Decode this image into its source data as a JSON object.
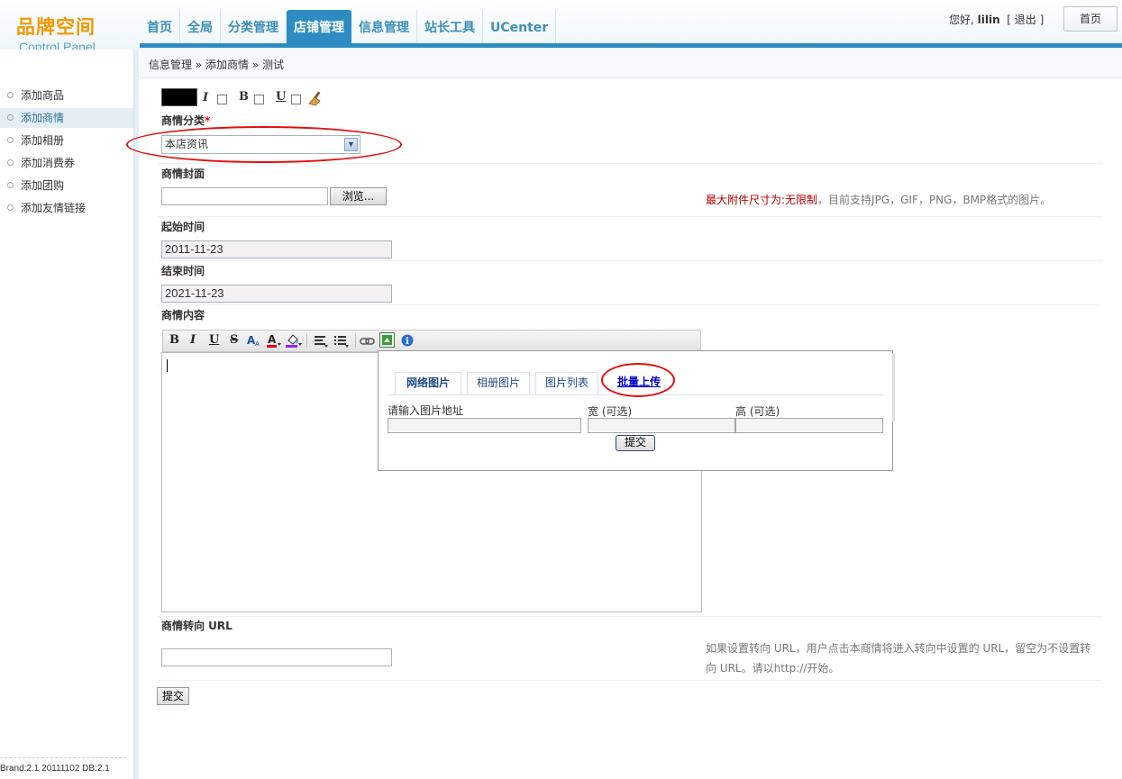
{
  "header": {
    "logo_cn": "品牌空间",
    "logo_en": "Control Panel",
    "nav": [
      "首页",
      "全局",
      "分类管理",
      "店铺管理",
      "信息管理",
      "站长工具",
      "UCenter"
    ],
    "active_nav": "店铺管理",
    "greeting": "您好,",
    "username": "lilin",
    "logout": "[ 退出 ]",
    "home_button": "首页"
  },
  "breadcrumb": "信息管理 » 添加商情 » 测试",
  "sidebar": {
    "items": [
      {
        "label": "添加商品"
      },
      {
        "label": "添加商情",
        "active": true
      },
      {
        "label": "添加相册"
      },
      {
        "label": "添加消费券"
      },
      {
        "label": "添加团购"
      },
      {
        "label": "添加友情链接"
      }
    ],
    "version": "Brand:2.1 20111102 DB:2.1"
  },
  "form": {
    "category_label": "商情分类",
    "category_required": "*",
    "category_value": "本店资讯",
    "cover_label": "商情封面",
    "browse_button": "浏览...",
    "upload_note_red": "最大附件尺寸为:无限制",
    "upload_note": "，目前支持JPG，GIF，PNG，BMP格式的图片。",
    "start_label": "起始时间",
    "start_value": "2011-11-23",
    "end_label": "结束时间",
    "end_value": "2021-11-23",
    "content_label": "商情内容",
    "redirect_label": "商情转向 URL",
    "redirect_value": "",
    "redirect_note_1": "如果设置转向 URL，用户点击本商情将进入转向中设置的 URL，留空为不设置转",
    "redirect_note_2": "向 URL。请以http://开始。",
    "submit_button": "提交"
  },
  "style_toolbar": {
    "color": "#000000",
    "italic": "I",
    "bold": "B",
    "underline": "U",
    "icons": [
      "color-swatch",
      "italic-checkbox",
      "bold-checkbox",
      "underline-checkbox",
      "broom-icon"
    ]
  },
  "editor": {
    "toolbar": [
      "B",
      "I",
      "U",
      "S"
    ],
    "icons": [
      "font-size-icon",
      "font-color-icon",
      "highlight-icon",
      "align-icon",
      "list-icon",
      "link-icon",
      "image-icon",
      "info-icon"
    ]
  },
  "image_popup": {
    "tabs": [
      "网络图片",
      "相册图片",
      "图片列表",
      "批量上传"
    ],
    "active_tab": "网络图片",
    "url_label": "请输入图片地址",
    "width_label": "宽 (可选)",
    "height_label": "高 (可选)",
    "submit": "提交"
  },
  "colors": {
    "accent": "#2d8dc2",
    "logo": "#f39800",
    "highlight_oval": "#e01010"
  }
}
